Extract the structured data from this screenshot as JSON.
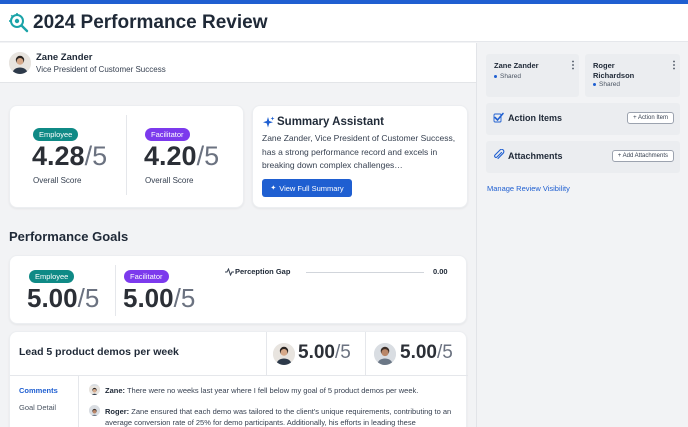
{
  "header": {
    "title": "2024 Performance Review",
    "logo_icon": "review-gear-icon"
  },
  "user": {
    "name": "Zane Zander",
    "role": "Vice President of Customer Success"
  },
  "scores": {
    "employee": {
      "badge": "Employee",
      "value": "4.28",
      "denominator": "/5",
      "caption": "Overall Score"
    },
    "facilitator": {
      "badge": "Facilitator",
      "value": "4.20",
      "denominator": "/5",
      "caption": "Overall Score"
    }
  },
  "summary": {
    "title": "Summary Assistant",
    "text": "Zane Zander, Vice President of Customer Success, has a strong performance record and excels in breaking down complex challenges…",
    "button": "View Full Summary"
  },
  "goals_section": {
    "title": "Performance Goals",
    "employee_badge": "Employee",
    "employee_value": "5.00",
    "employee_den": "/5",
    "facilitator_badge": "Facilitator",
    "facilitator_value": "5.00",
    "facilitator_den": "/5",
    "perception_label": "Perception Gap",
    "perception_value": "0.00"
  },
  "goal": {
    "title": "Lead 5 product demos per week",
    "score1": "5.00",
    "score1_den": "/5",
    "score2": "5.00",
    "score2_den": "/5",
    "tabs": [
      "Comments",
      "Goal Detail"
    ],
    "comments": [
      {
        "author": "Zane:",
        "text": "There were no weeks last year where I fell below my goal of 5 product demos per week."
      },
      {
        "author": "Roger:",
        "text": "Zane ensured that each demo was tailored to the client's unique requirements, contributing to an average conversion rate of 25% for demo participants. Additionally, his efforts in leading these"
      }
    ]
  },
  "sidebar": {
    "participants": [
      {
        "name": "Zane Zander",
        "status": "Shared"
      },
      {
        "name": "Roger Richardson",
        "status": "Shared"
      }
    ],
    "action_items": {
      "label": "Action Items",
      "button": "+ Action Item"
    },
    "attachments": {
      "label": "Attachments",
      "button": "+ Add Attachments"
    },
    "visibility_link": "Manage Review Visibility"
  },
  "colors": {
    "accent": "#1f5fd1",
    "employee": "#0f8a86",
    "facilitator": "#7c3aed"
  }
}
